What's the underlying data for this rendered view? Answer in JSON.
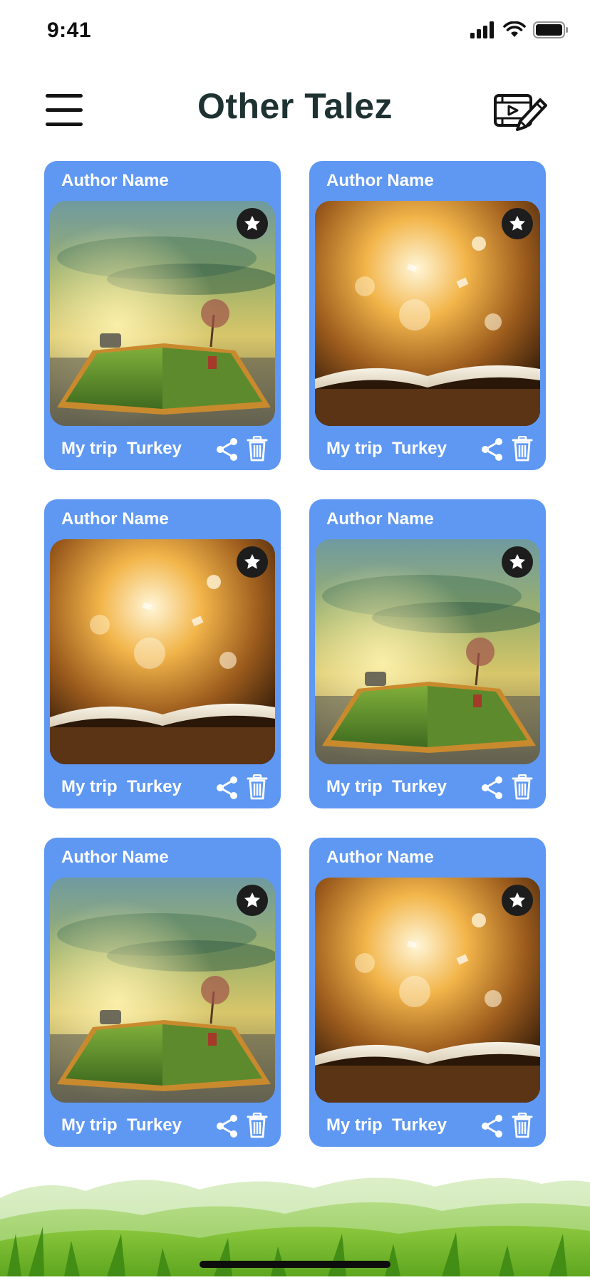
{
  "status_bar": {
    "time": "9:41",
    "icons": [
      "signal-icon",
      "wifi-icon",
      "battery-icon"
    ]
  },
  "header": {
    "title": "Other Talez",
    "menu_icon": "hamburger-menu-icon",
    "action_icon": "video-edit-icon"
  },
  "cards": [
    {
      "author": "Author Name",
      "title": "My trip  Turkey",
      "image": "book-landscape-image"
    },
    {
      "author": "Author Name",
      "title": "My trip  Turkey",
      "image": "book-golden-image"
    },
    {
      "author": "Author Name",
      "title": "My trip  Turkey",
      "image": "book-golden-image"
    },
    {
      "author": "Author Name",
      "title": "My trip  Turkey",
      "image": "book-landscape-image"
    },
    {
      "author": "Author Name",
      "title": "My trip  Turkey",
      "image": "book-landscape-image"
    },
    {
      "author": "Author Name",
      "title": "My trip  Turkey",
      "image": "book-golden-image"
    }
  ],
  "colors": {
    "card": "#5f98f3",
    "title": "#1f3232",
    "favorite_badge": "#1d1d1d"
  }
}
